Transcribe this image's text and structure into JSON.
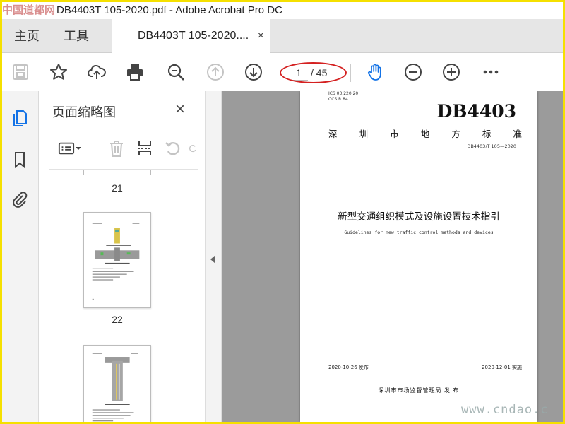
{
  "window": {
    "watermark": "中国道都网",
    "title": "DB4403T 105-2020.pdf - Adobe Acrobat Pro DC"
  },
  "tabs": {
    "home": "主页",
    "tools": "工具",
    "document": "DB4403T 105-2020....",
    "close": "×"
  },
  "toolbar": {
    "icons": [
      "save-icon",
      "star-icon",
      "upload-cloud-icon",
      "print-icon",
      "zoom-search-icon",
      "page-up-icon",
      "page-down-icon",
      "hand-icon",
      "zoom-out-icon",
      "zoom-in-icon",
      "more-icon"
    ],
    "current_page": "1",
    "total_pages": "/ 45",
    "accent": "#1473e6",
    "highlight_ring": "#d42020"
  },
  "sidebar": {
    "title": "页面缩略图",
    "close": "×",
    "thumbnails": [
      {
        "number": "21"
      },
      {
        "number": "22"
      }
    ]
  },
  "document": {
    "ics": "ICS 03.220.20",
    "ccs": "CCS R 84",
    "code": "DB4403",
    "type_chars": [
      "深",
      "圳",
      "市",
      "地",
      "方",
      "标",
      "准"
    ],
    "std_number": "DB4403/T 105—2020",
    "title_zh": "新型交通组织模式及设施设置技术指引",
    "title_en": "Guidelines for new traffic control methods and devices",
    "date_issue": "2020-10-26 发布",
    "date_impl": "2020-12-01 实施",
    "issuer": "深圳市市场监督管理局    发 布"
  },
  "footer_watermark": "www.cndao.c"
}
